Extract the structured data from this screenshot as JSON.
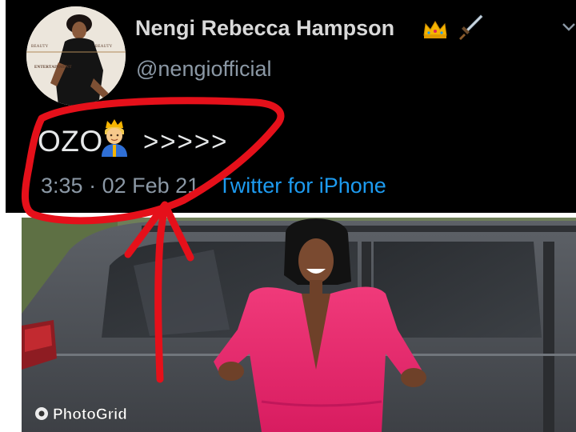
{
  "tweet": {
    "display_name": "Nengi Rebecca Hampson",
    "handle": "@nengiofficial",
    "name_icons": [
      "crown-icon",
      "dagger-icon"
    ],
    "text_prefix": "OZO",
    "text_icon": "prince-icon",
    "text_suffix": ">>>>>",
    "time": "3:35",
    "date": "02 Feb 21",
    "separator": "·",
    "source": "Twitter for iPhone",
    "avatar_magazine_labels": [
      "BEAUTY",
      "ENTERTAINMENT"
    ]
  },
  "watermark": {
    "label": "PhotoGrid"
  },
  "colors": {
    "tweet_background": "#000000",
    "name_text": "#d9d9d9",
    "secondary_text": "#8b98a5",
    "link": "#1d9bf0",
    "annotation_red": "#e5101a",
    "dress_pink": "#e8246a"
  }
}
